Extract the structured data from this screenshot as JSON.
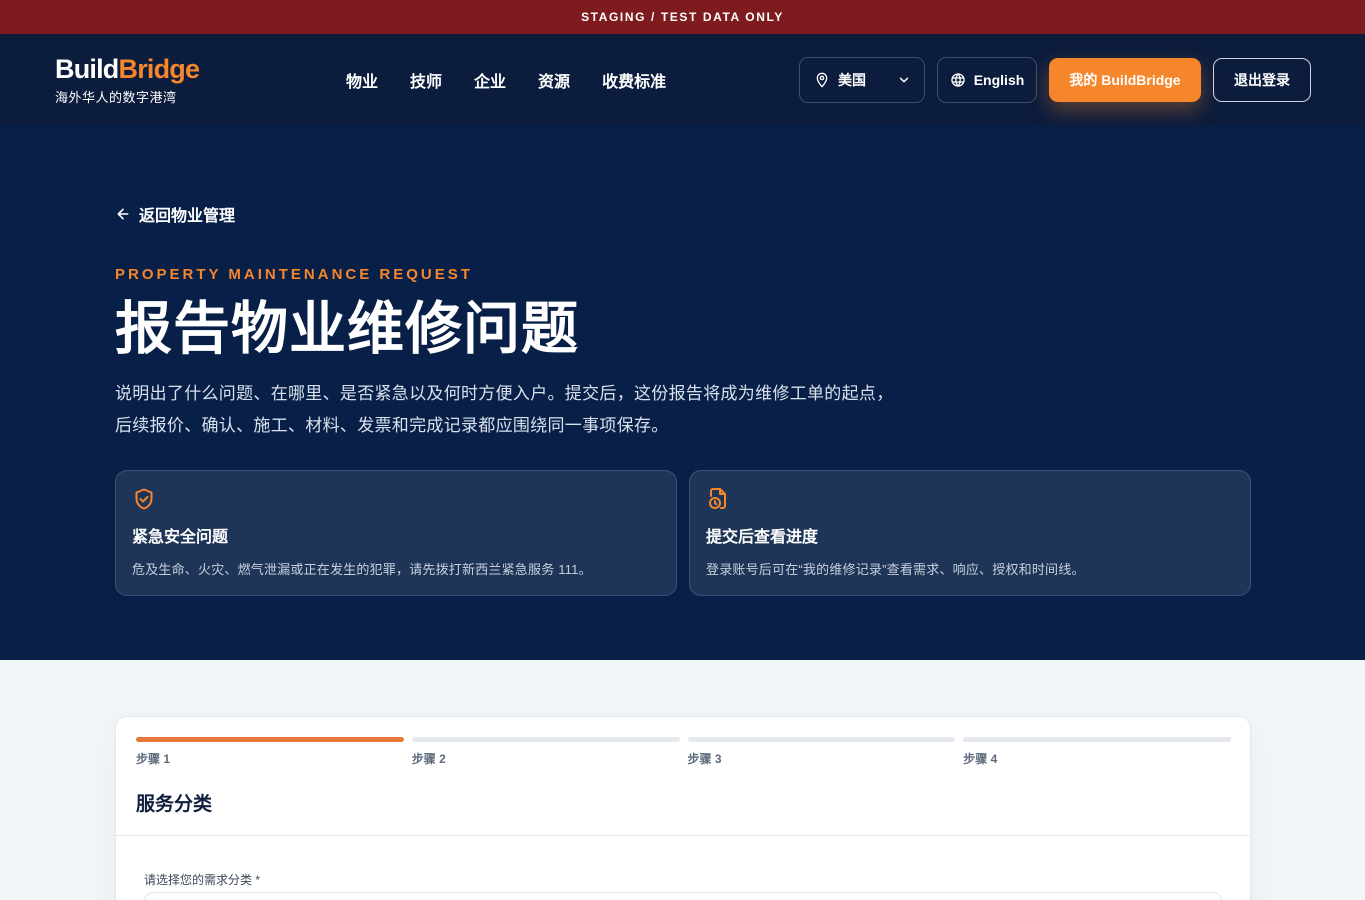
{
  "banner": {
    "text": "STAGING / TEST DATA ONLY"
  },
  "header": {
    "logo_part1": "Build",
    "logo_part2": "Bridge",
    "logo_tagline": "海外华人的数字港湾",
    "nav": [
      {
        "label": "物业"
      },
      {
        "label": "技师"
      },
      {
        "label": "企业"
      },
      {
        "label": "资源"
      },
      {
        "label": "收费标准"
      }
    ],
    "region": {
      "label": "美国",
      "icon": "map-pin-icon"
    },
    "language": {
      "label": "English",
      "icon": "globe-icon"
    },
    "my_button": "我的 BuildBridge",
    "logout_button": "退出登录"
  },
  "hero": {
    "back_link": "返回物业管理",
    "eyebrow": "PROPERTY MAINTENANCE REQUEST",
    "title": "报告物业维修问题",
    "description": "说明出了什么问题、在哪里、是否紧急以及何时方便入户。提交后，这份报告将成为维修工单的起点，后续报价、确认、施工、材料、发票和完成记录都应围绕同一事项保存。",
    "cards": [
      {
        "icon": "shield-check-icon",
        "title": "紧急安全问题",
        "text": "危及生命、火灾、燃气泄漏或正在发生的犯罪，请先拨打新西兰紧急服务 111。"
      },
      {
        "icon": "file-clock-icon",
        "title": "提交后查看进度",
        "text": "登录账号后可在“我的维修记录”查看需求、响应、授权和时间线。"
      }
    ]
  },
  "form": {
    "steps": [
      {
        "label": "步骤 1",
        "active": true
      },
      {
        "label": "步骤 2",
        "active": false
      },
      {
        "label": "步骤 3",
        "active": false
      },
      {
        "label": "步骤 4",
        "active": false
      }
    ],
    "section_title": "服务分类",
    "category_label": "请选择您的需求分类 *"
  },
  "colors": {
    "accent": "#f5862c",
    "navy": "#082048",
    "banner": "#7d1b1e"
  }
}
